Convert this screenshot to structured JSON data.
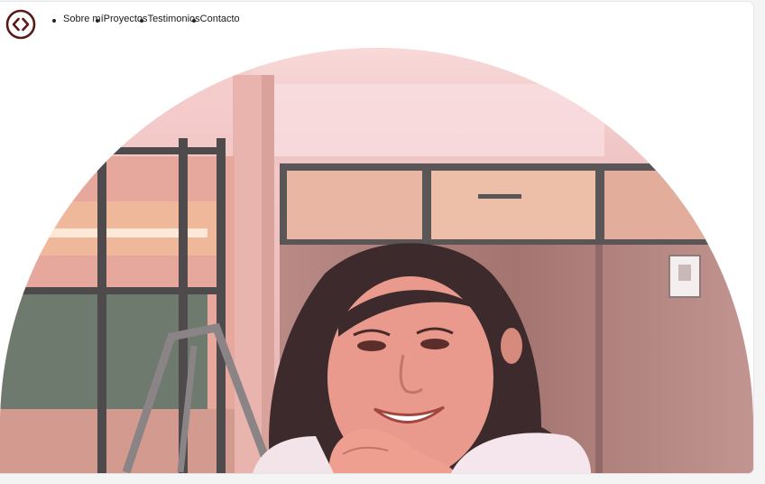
{
  "logo": {
    "icon": "code-brackets-icon",
    "color": "#5a1a1a"
  },
  "nav": {
    "items": [
      {
        "label": "Sobre mí"
      },
      {
        "label": "Proyectos"
      },
      {
        "label": "Testimonios"
      },
      {
        "label": "Contacto"
      }
    ]
  },
  "hero": {
    "photo": "portrait-photo"
  }
}
